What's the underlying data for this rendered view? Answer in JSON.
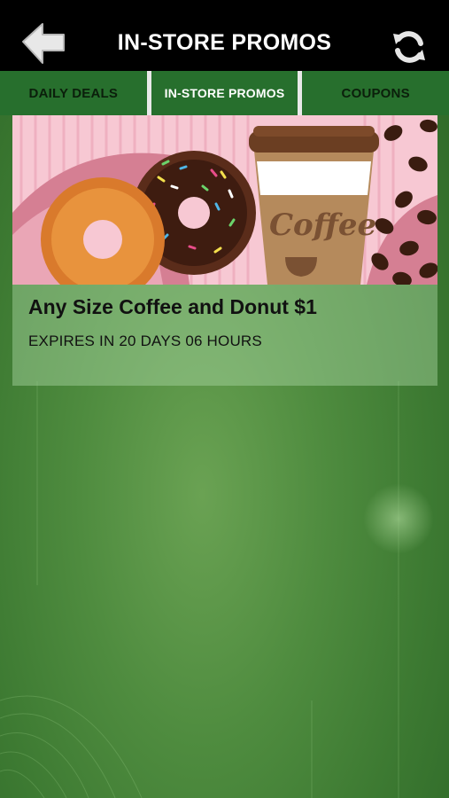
{
  "header": {
    "title": "IN-STORE PROMOS",
    "back_icon": "back-arrow-icon",
    "refresh_icon": "refresh-icon"
  },
  "tabs": [
    {
      "label": "DAILY DEALS",
      "active": false
    },
    {
      "label": "IN-STORE PROMOS",
      "active": true
    },
    {
      "label": "COUPONS",
      "active": false
    }
  ],
  "promo": {
    "title": "Any Size Coffee and Donut $1",
    "expiry": "EXPIRES IN 20 DAYS 06 HOURS",
    "image_cup_text": "Coffee"
  },
  "colors": {
    "header_bg": "#000000",
    "tab_bar_bg": "#276f2d",
    "background_green": "#4f8c3f",
    "card_image_pink": "#f3b9c7"
  }
}
